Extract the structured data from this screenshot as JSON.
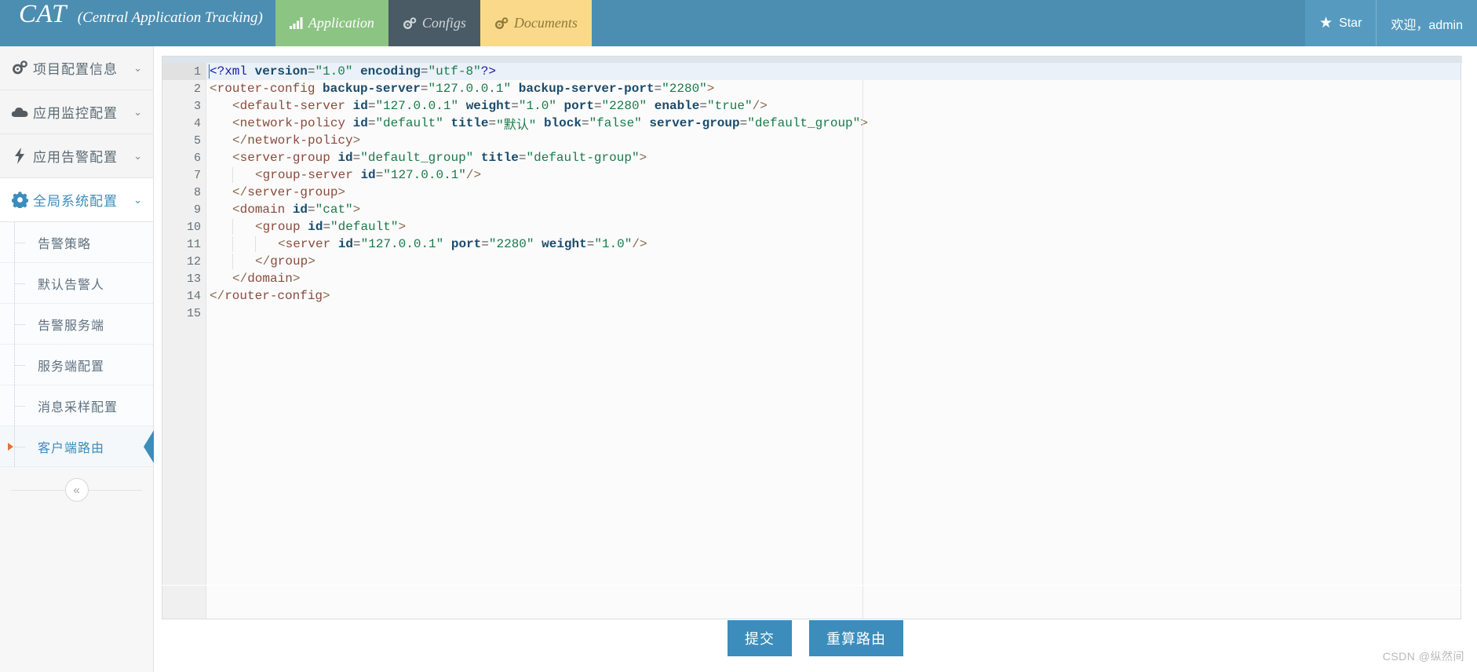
{
  "navbar": {
    "brand_main": "CAT",
    "brand_sub": "(Central Application Tracking)",
    "bg_color": "#4c8eb2",
    "tabs": [
      {
        "label": "Application",
        "icon": "bar-chart-icon",
        "bg": "#8cc483",
        "fg": "#ffffff"
      },
      {
        "label": "Configs",
        "icon": "gears-icon",
        "bg": "#4a5b66",
        "fg": "#cfd6da"
      },
      {
        "label": "Documents",
        "icon": "gears-icon",
        "bg": "#fada8a",
        "fg": "#8d7a3a"
      }
    ],
    "right": {
      "star_icon": "star-icon",
      "star_label": "Star",
      "user_label": "欢迎，admin"
    }
  },
  "sidebar": {
    "groups": [
      {
        "label": "项目配置信息",
        "icon": "gears-icon",
        "caret": "⌄",
        "active": false
      },
      {
        "label": "应用监控配置",
        "icon": "cloud-icon",
        "caret": "⌄",
        "active": false
      },
      {
        "label": "应用告警配置",
        "icon": "bolt-icon",
        "caret": "⌄",
        "active": false
      },
      {
        "label": "全局系统配置",
        "icon": "gear-icon",
        "caret": "⌄",
        "active": true
      }
    ],
    "submenu": [
      {
        "label": "告警策略",
        "current": false
      },
      {
        "label": "默认告警人",
        "current": false
      },
      {
        "label": "告警服务端",
        "current": false
      },
      {
        "label": "服务端配置",
        "current": false
      },
      {
        "label": "消息采样配置",
        "current": false
      },
      {
        "label": "客户端路由",
        "current": true
      }
    ],
    "collapse_icon": "«",
    "accent_color": "#3c8dbc",
    "marker_color": "#e8703a"
  },
  "editor": {
    "total_lines": 15,
    "active_line": 1,
    "fold_lines": [
      2,
      4,
      6,
      9,
      10
    ],
    "lines": [
      {
        "n": 1,
        "indent": 0,
        "tokens": [
          {
            "c": "t-meta",
            "s": "<?xml"
          },
          {
            "c": "t-plain",
            "s": " "
          },
          {
            "c": "t-attr",
            "s": "version"
          },
          {
            "c": "t-eq",
            "s": "="
          },
          {
            "c": "t-val",
            "s": "\"1.0\""
          },
          {
            "c": "t-plain",
            "s": " "
          },
          {
            "c": "t-attr",
            "s": "encoding"
          },
          {
            "c": "t-eq",
            "s": "="
          },
          {
            "c": "t-val",
            "s": "\"utf-8\""
          },
          {
            "c": "t-meta",
            "s": "?>"
          }
        ]
      },
      {
        "n": 2,
        "indent": 0,
        "tokens": [
          {
            "c": "t-punct",
            "s": "<"
          },
          {
            "c": "t-tag",
            "s": "router-config"
          },
          {
            "c": "t-plain",
            "s": " "
          },
          {
            "c": "t-attr",
            "s": "backup-server"
          },
          {
            "c": "t-eq",
            "s": "="
          },
          {
            "c": "t-val",
            "s": "\"127.0.0.1\""
          },
          {
            "c": "t-plain",
            "s": " "
          },
          {
            "c": "t-attr",
            "s": "backup-server-port"
          },
          {
            "c": "t-eq",
            "s": "="
          },
          {
            "c": "t-val",
            "s": "\"2280\""
          },
          {
            "c": "t-punct",
            "s": ">"
          }
        ]
      },
      {
        "n": 3,
        "indent": 1,
        "tokens": [
          {
            "c": "t-punct",
            "s": "<"
          },
          {
            "c": "t-tag",
            "s": "default-server"
          },
          {
            "c": "t-plain",
            "s": " "
          },
          {
            "c": "t-attr",
            "s": "id"
          },
          {
            "c": "t-eq",
            "s": "="
          },
          {
            "c": "t-val",
            "s": "\"127.0.0.1\""
          },
          {
            "c": "t-plain",
            "s": " "
          },
          {
            "c": "t-attr",
            "s": "weight"
          },
          {
            "c": "t-eq",
            "s": "="
          },
          {
            "c": "t-val",
            "s": "\"1.0\""
          },
          {
            "c": "t-plain",
            "s": " "
          },
          {
            "c": "t-attr",
            "s": "port"
          },
          {
            "c": "t-eq",
            "s": "="
          },
          {
            "c": "t-val",
            "s": "\"2280\""
          },
          {
            "c": "t-plain",
            "s": " "
          },
          {
            "c": "t-attr",
            "s": "enable"
          },
          {
            "c": "t-eq",
            "s": "="
          },
          {
            "c": "t-val",
            "s": "\"true\""
          },
          {
            "c": "t-punct",
            "s": "/>"
          }
        ]
      },
      {
        "n": 4,
        "indent": 1,
        "tokens": [
          {
            "c": "t-punct",
            "s": "<"
          },
          {
            "c": "t-tag",
            "s": "network-policy"
          },
          {
            "c": "t-plain",
            "s": " "
          },
          {
            "c": "t-attr",
            "s": "id"
          },
          {
            "c": "t-eq",
            "s": "="
          },
          {
            "c": "t-val",
            "s": "\"default\""
          },
          {
            "c": "t-plain",
            "s": " "
          },
          {
            "c": "t-attr",
            "s": "title"
          },
          {
            "c": "t-eq",
            "s": "="
          },
          {
            "c": "t-val",
            "s": "\"默认\""
          },
          {
            "c": "t-plain",
            "s": " "
          },
          {
            "c": "t-attr",
            "s": "block"
          },
          {
            "c": "t-eq",
            "s": "="
          },
          {
            "c": "t-val",
            "s": "\"false\""
          },
          {
            "c": "t-plain",
            "s": " "
          },
          {
            "c": "t-attr",
            "s": "server-group"
          },
          {
            "c": "t-eq",
            "s": "="
          },
          {
            "c": "t-val",
            "s": "\"default_group\""
          },
          {
            "c": "t-punct",
            "s": ">"
          }
        ]
      },
      {
        "n": 5,
        "indent": 1,
        "tokens": [
          {
            "c": "t-punct",
            "s": "</"
          },
          {
            "c": "t-tag",
            "s": "network-policy"
          },
          {
            "c": "t-punct",
            "s": ">"
          }
        ]
      },
      {
        "n": 6,
        "indent": 1,
        "tokens": [
          {
            "c": "t-punct",
            "s": "<"
          },
          {
            "c": "t-tag",
            "s": "server-group"
          },
          {
            "c": "t-plain",
            "s": " "
          },
          {
            "c": "t-attr",
            "s": "id"
          },
          {
            "c": "t-eq",
            "s": "="
          },
          {
            "c": "t-val",
            "s": "\"default_group\""
          },
          {
            "c": "t-plain",
            "s": " "
          },
          {
            "c": "t-attr",
            "s": "title"
          },
          {
            "c": "t-eq",
            "s": "="
          },
          {
            "c": "t-val",
            "s": "\"default-group\""
          },
          {
            "c": "t-punct",
            "s": ">"
          }
        ]
      },
      {
        "n": 7,
        "indent": 2,
        "tokens": [
          {
            "c": "t-punct",
            "s": "<"
          },
          {
            "c": "t-tag",
            "s": "group-server"
          },
          {
            "c": "t-plain",
            "s": " "
          },
          {
            "c": "t-attr",
            "s": "id"
          },
          {
            "c": "t-eq",
            "s": "="
          },
          {
            "c": "t-val",
            "s": "\"127.0.0.1\""
          },
          {
            "c": "t-punct",
            "s": "/>"
          }
        ]
      },
      {
        "n": 8,
        "indent": 1,
        "tokens": [
          {
            "c": "t-punct",
            "s": "</"
          },
          {
            "c": "t-tag",
            "s": "server-group"
          },
          {
            "c": "t-punct",
            "s": ">"
          }
        ]
      },
      {
        "n": 9,
        "indent": 1,
        "tokens": [
          {
            "c": "t-punct",
            "s": "<"
          },
          {
            "c": "t-tag",
            "s": "domain"
          },
          {
            "c": "t-plain",
            "s": " "
          },
          {
            "c": "t-attr",
            "s": "id"
          },
          {
            "c": "t-eq",
            "s": "="
          },
          {
            "c": "t-val",
            "s": "\"cat\""
          },
          {
            "c": "t-punct",
            "s": ">"
          }
        ]
      },
      {
        "n": 10,
        "indent": 2,
        "tokens": [
          {
            "c": "t-punct",
            "s": "<"
          },
          {
            "c": "t-tag",
            "s": "group"
          },
          {
            "c": "t-plain",
            "s": " "
          },
          {
            "c": "t-attr",
            "s": "id"
          },
          {
            "c": "t-eq",
            "s": "="
          },
          {
            "c": "t-val",
            "s": "\"default\""
          },
          {
            "c": "t-punct",
            "s": ">"
          }
        ]
      },
      {
        "n": 11,
        "indent": 3,
        "tokens": [
          {
            "c": "t-punct",
            "s": "<"
          },
          {
            "c": "t-tag",
            "s": "server"
          },
          {
            "c": "t-plain",
            "s": " "
          },
          {
            "c": "t-attr",
            "s": "id"
          },
          {
            "c": "t-eq",
            "s": "="
          },
          {
            "c": "t-val",
            "s": "\"127.0.0.1\""
          },
          {
            "c": "t-plain",
            "s": " "
          },
          {
            "c": "t-attr",
            "s": "port"
          },
          {
            "c": "t-eq",
            "s": "="
          },
          {
            "c": "t-val",
            "s": "\"2280\""
          },
          {
            "c": "t-plain",
            "s": " "
          },
          {
            "c": "t-attr",
            "s": "weight"
          },
          {
            "c": "t-eq",
            "s": "="
          },
          {
            "c": "t-val",
            "s": "\"1.0\""
          },
          {
            "c": "t-punct",
            "s": "/>"
          }
        ]
      },
      {
        "n": 12,
        "indent": 2,
        "tokens": [
          {
            "c": "t-punct",
            "s": "</"
          },
          {
            "c": "t-tag",
            "s": "group"
          },
          {
            "c": "t-punct",
            "s": ">"
          }
        ]
      },
      {
        "n": 13,
        "indent": 1,
        "tokens": [
          {
            "c": "t-punct",
            "s": "</"
          },
          {
            "c": "t-tag",
            "s": "domain"
          },
          {
            "c": "t-punct",
            "s": ">"
          }
        ]
      },
      {
        "n": 14,
        "indent": 0,
        "tokens": [
          {
            "c": "t-punct",
            "s": "</"
          },
          {
            "c": "t-tag",
            "s": "router-config"
          },
          {
            "c": "t-punct",
            "s": ">"
          }
        ]
      },
      {
        "n": 15,
        "indent": 0,
        "tokens": []
      }
    ]
  },
  "footer": {
    "buttons": [
      {
        "label": "提交",
        "name": "submit-button"
      },
      {
        "label": "重算路由",
        "name": "recalculate-route-button"
      }
    ],
    "button_color": "#3c8dbc"
  },
  "watermark": "CSDN @纵然间"
}
